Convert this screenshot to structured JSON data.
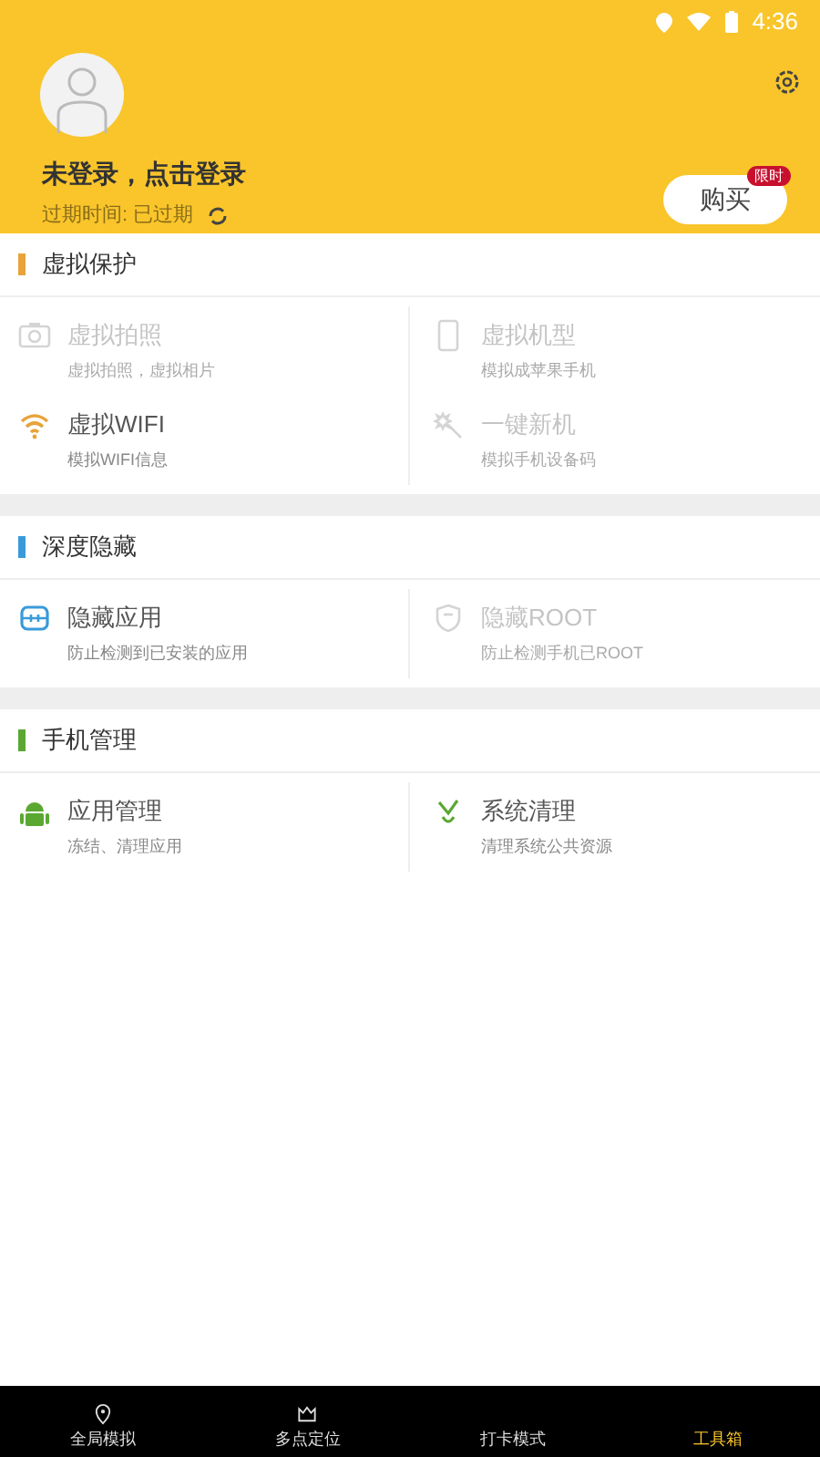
{
  "status_bar": {
    "time": "4:36"
  },
  "profile": {
    "login_prompt": "未登录，点击登录",
    "expiry": "过期时间: 已过期",
    "buy_button": "购买",
    "buy_badge": "限时"
  },
  "sections": [
    {
      "title": "虚拟保护",
      "color": "#e8a33a",
      "items": [
        {
          "kind": "camera",
          "title": "虚拟拍照",
          "subtitle": "虚拟拍照，虚拟相片",
          "disabled": true
        },
        {
          "kind": "phone",
          "title": "虚拟机型",
          "subtitle": "模拟成苹果手机",
          "disabled": true
        },
        {
          "kind": "wifi",
          "title": "虚拟WIFI",
          "subtitle": "模拟WIFI信息",
          "disabled": false
        },
        {
          "kind": "wand",
          "title": "一键新机",
          "subtitle": "模拟手机设备码",
          "disabled": true
        }
      ]
    },
    {
      "title": "深度隐藏",
      "color": "#3a9ad9",
      "items": [
        {
          "kind": "app",
          "title": "隐藏应用",
          "subtitle": "防止检测到已安装的应用",
          "disabled": false
        },
        {
          "kind": "shield",
          "title": "隐藏ROOT",
          "subtitle": "防止检测手机已ROOT",
          "disabled": true
        }
      ]
    },
    {
      "title": "手机管理",
      "color": "#5aa832",
      "items": [
        {
          "kind": "android",
          "title": "应用管理",
          "subtitle": "冻结、清理应用",
          "disabled": false
        },
        {
          "kind": "broom",
          "title": "系统清理",
          "subtitle": "清理系统公共资源",
          "disabled": false
        }
      ]
    }
  ],
  "bottom_nav": [
    {
      "kind": "pin",
      "label": "全局模拟",
      "selected": false
    },
    {
      "kind": "crown",
      "label": "多点定位",
      "selected": false
    },
    {
      "label": "打卡模式",
      "selected": false
    },
    {
      "label": "工具箱",
      "selected": true
    }
  ]
}
